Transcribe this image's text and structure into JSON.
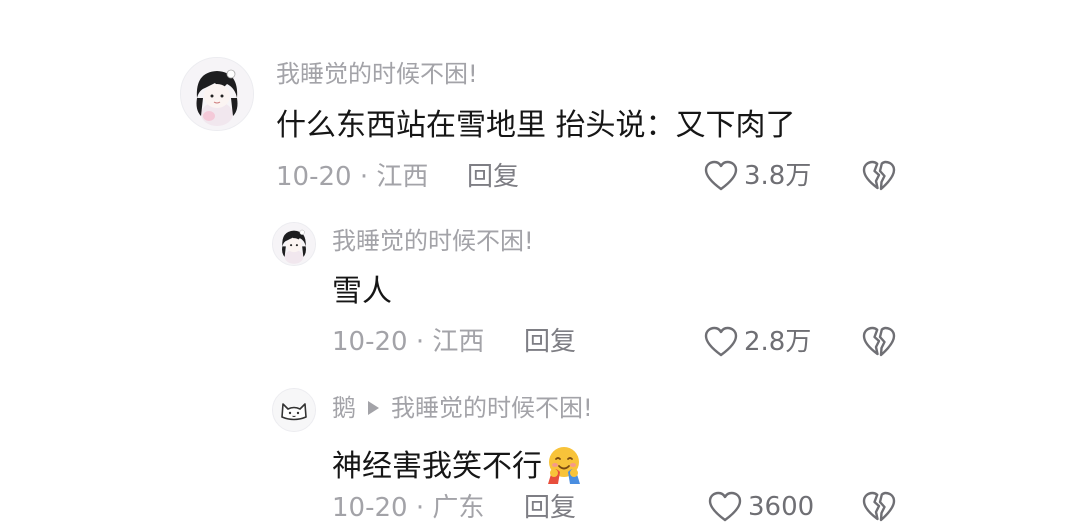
{
  "comments": [
    {
      "username": "我睡觉的时候不困!",
      "content": "什么东西站在雪地里 抬头说：又下肉了",
      "meta": "10-20 · 江西",
      "reply_label": "回复",
      "likes": "3.8万",
      "avatar_icon": "girl-avatar-icon"
    },
    {
      "username": "我睡觉的时候不困!",
      "content": "雪人",
      "meta": "10-20 · 江西",
      "reply_label": "回复",
      "likes": "2.8万",
      "avatar_icon": "girl-avatar-icon"
    },
    {
      "username": "鹅",
      "reply_to": "我睡觉的时候不困!",
      "content": "神经害我笑不行",
      "content_emoji": "hug-emoji-icon",
      "meta": "10-20 · 广东",
      "reply_label": "回复",
      "likes": "3600",
      "avatar_icon": "cat-avatar-icon"
    }
  ],
  "colors": {
    "background": "#ffffff",
    "username": "#a3a3a8",
    "content": "#161616",
    "meta": "#a3a3a8",
    "icon": "#6f6f74"
  }
}
